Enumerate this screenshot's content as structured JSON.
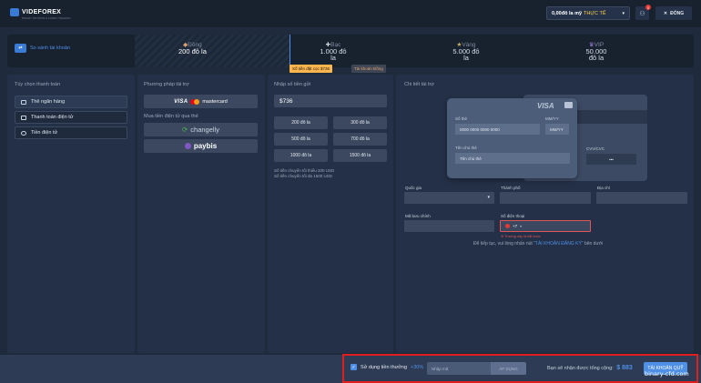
{
  "header": {
    "logo": "VIDEFOREX",
    "logo_sub": "BINARY OPTIONS & FOREX TRADING",
    "account_amount": "0,00đô la mỹ",
    "account_type": "THỰC TẾ",
    "notif_count": "0",
    "close_label": "ĐÓNG"
  },
  "tiers": {
    "compare_label": "So sánh tài khoản",
    "items": [
      {
        "name": "Đồng",
        "amount": "200 đô la"
      },
      {
        "name": "Bạc",
        "amount": "1.000 đô la"
      },
      {
        "name": "Vàng",
        "amount": "5.000 đô la"
      },
      {
        "name": "VIP",
        "amount": "50.000 đô la"
      }
    ],
    "deposit_tag": "Số tiền đặt cọc $736",
    "real_tag": "Tài khoản Đồng"
  },
  "payment_options": {
    "title": "Tùy chọn thanh toán",
    "items": [
      "Thẻ ngân hàng",
      "Thanh toán điện tử",
      "Tiền điện tử"
    ]
  },
  "funding": {
    "title": "Phương pháp tài trợ",
    "card_visa": "VISA",
    "card_mc": "mastercard",
    "crypto_title": "Mua tiền điện tử qua thẻ",
    "changelly": "changelly",
    "paybis": "paybis"
  },
  "amount": {
    "title": "Nhập số tiền gửi",
    "value": "$736",
    "presets": [
      "200 đô la",
      "300 đô la",
      "500 đô la",
      "700 đô la",
      "1000 đô la",
      "1500 đô la"
    ],
    "min_text": "Số tiền chuyển tối thiểu 200 USD",
    "max_text": "Số tiền chuyển tối đa 1500 USD"
  },
  "details": {
    "title": "Chi tiết tài trợ",
    "card_brand": "VISA",
    "card_number_label": "Số thẻ",
    "card_number_placeholder": "0000 0000 0000 0000",
    "expiry_label": "MM/YY",
    "expiry_placeholder": "MM/YY",
    "holder_label": "Tên chủ thẻ",
    "holder_placeholder": "Tên chủ thẻ",
    "cvv_label": "CVV/CVC",
    "cvv_placeholder": "•••",
    "country_label": "Quốc gia",
    "city_label": "Thành phố",
    "address_label": "Địa chỉ",
    "zip_label": "Mã bưu chính",
    "phone_label": "Số điện thoại",
    "phone_code": "+7",
    "phone_error": "Trường này là bắt buộc",
    "hint_prefix": "Để tiếp tục, vui lòng nhấn nút",
    "hint_link": "\"TÀI KHOẢN ĐĂNG KÝ\"",
    "hint_suffix": "bên dưới"
  },
  "bottom": {
    "bonus_label": "Sử dụng tiền thưởng",
    "bonus_pct": "+30%",
    "code_placeholder": "Nhập mã",
    "apply_label": "ÁP DỤNG",
    "total_label": "Bạn sẽ nhận được tổng cộng:",
    "total_amount": "$ 883",
    "submit_label": "TÀI KHOẢN QUỸ",
    "watermark": "binary-cfd.com"
  }
}
